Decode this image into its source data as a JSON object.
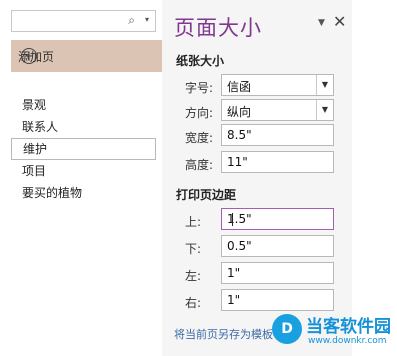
{
  "search": {
    "icon": "search-icon"
  },
  "add_page": {
    "label": "添加页"
  },
  "pages": [
    "景观",
    "联系人",
    "维护",
    "项目",
    "要买的植物"
  ],
  "pane": {
    "title": "页面大小",
    "paper_size": {
      "heading": "纸张大小",
      "size_label": "字号:",
      "size_value": "信函",
      "orientation_label": "方向:",
      "orientation_value": "纵向",
      "width_label": "宽度:",
      "width_value": "8.5\"",
      "height_label": "高度:",
      "height_value": "11\""
    },
    "margins": {
      "heading": "打印页边距",
      "top_label": "上:",
      "top_value": "1.5\"",
      "bottom_label": "下:",
      "bottom_value": "0.5\"",
      "left_label": "左:",
      "left_value": "1\"",
      "right_label": "右:",
      "right_value": "1\""
    },
    "save_link": "将当前页另存为模板"
  },
  "watermark": {
    "text": "当客软件园",
    "url": "www.downkr.com"
  },
  "colors": {
    "title": "#80398f",
    "accent_bar": "#dcc4b4",
    "link": "#3b6aa8"
  }
}
